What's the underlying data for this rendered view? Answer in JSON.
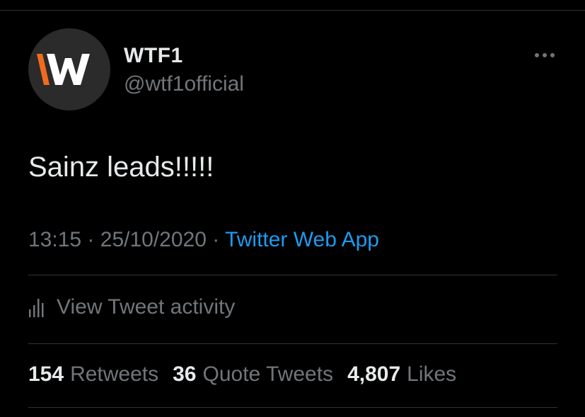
{
  "user": {
    "display_name": "WTF1",
    "handle": "@wtf1official",
    "avatar_logo_text": "W"
  },
  "tweet": {
    "text": "Sainz leads!!!!!",
    "time": "13:15",
    "separator": "·",
    "date": "25/10/2020",
    "source": "Twitter Web App"
  },
  "actions": {
    "more_icon": "more-horizontal-icon",
    "activity_icon": "bar-chart-icon",
    "view_activity_label": "View Tweet activity"
  },
  "stats": [
    {
      "count": "154",
      "label": "Retweets"
    },
    {
      "count": "36",
      "label": "Quote Tweets"
    },
    {
      "count": "4,807",
      "label": "Likes"
    }
  ],
  "colors": {
    "background": "#000000",
    "primary_text": "#e7e9ea",
    "secondary_text": "#71767b",
    "link": "#1d9bf0",
    "divider": "#2f3336",
    "logo_accent": "#f26b1d"
  }
}
